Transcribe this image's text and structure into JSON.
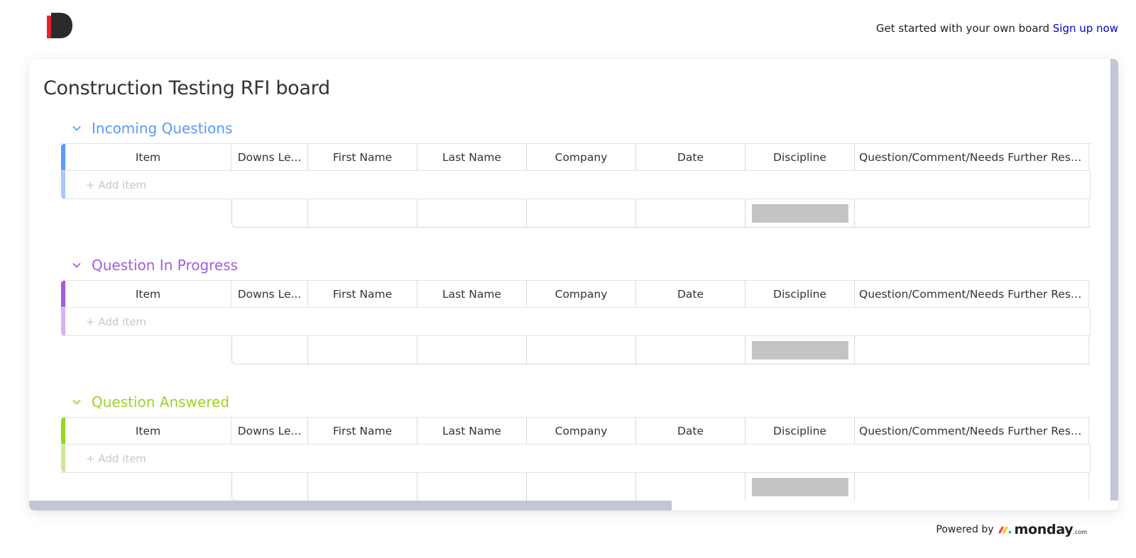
{
  "header": {
    "cta_text": "Get started with your own board",
    "cta_link": "Sign up now"
  },
  "board": {
    "title": "Construction Testing RFI board",
    "columns": [
      "Item",
      "Downs Le...",
      "First Name",
      "Last Name",
      "Company",
      "Date",
      "Discipline",
      "Question/Comment/Needs Further Rese..."
    ],
    "add_item_label": "+ Add item",
    "groups": [
      {
        "name": "Incoming Questions",
        "color": "#579bfc",
        "light": "#a7c8fb"
      },
      {
        "name": "Question In Progress",
        "color": "#a25ddc",
        "light": "#d3b4ef"
      },
      {
        "name": "Question Answered",
        "color": "#9cd326",
        "light": "#cdea97"
      }
    ]
  },
  "footer": {
    "powered_by": "Powered by",
    "brand": "monday",
    "brand_suffix": ".com"
  },
  "colors": {
    "accent_link": "#0000cc",
    "scrollbar": "#c3c6d4",
    "discipline_summary": "#c4c4c4"
  }
}
